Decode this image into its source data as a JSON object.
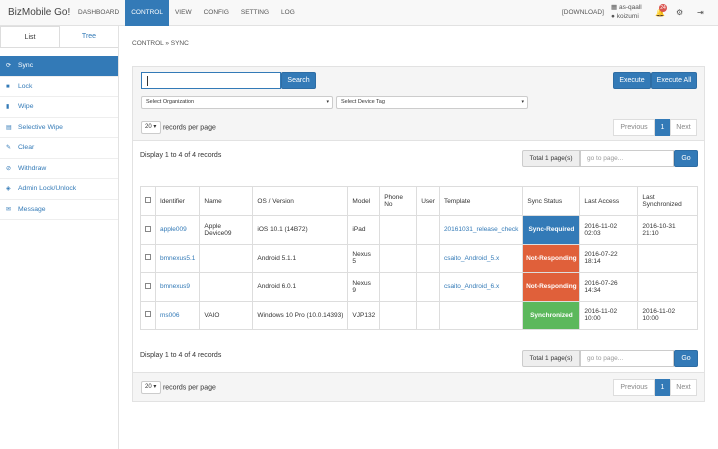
{
  "app": {
    "brand": "BizMobile Go!"
  },
  "nav": [
    "DASHBOARD",
    "CONTROL",
    "VIEW",
    "CONFIG",
    "SETTING",
    "LOG"
  ],
  "header": {
    "download": "[DOWNLOAD]",
    "user_line1": "as-qaall",
    "user_line2": "koizumi",
    "notif_count": "24"
  },
  "sidebar": {
    "tabs": [
      "List",
      "Tree"
    ],
    "items": [
      "Sync",
      "Lock",
      "Wipe",
      "Selective Wipe",
      "Clear",
      "Withdraw",
      "Admin Lock/Unlock",
      "Message"
    ]
  },
  "breadcrumb": "CONTROL » SYNC",
  "toolbar": {
    "search_label": "Search",
    "execute_label": "Execute",
    "execute_all_label": "Execute All"
  },
  "filters": {
    "org": "Select Organization",
    "tag": "Select Device Tag"
  },
  "paging": {
    "rpp_value": "20",
    "rpp_label": "records per page",
    "prev": "Previous",
    "page": "1",
    "next": "Next",
    "info": "Display 1 to 4 of 4 records",
    "total": "Total 1 page(s)",
    "goto_placeholder": "go to page...",
    "go": "Go"
  },
  "table": {
    "headers": [
      "",
      "Identifier",
      "Name",
      "OS / Version",
      "Model",
      "Phone No",
      "User",
      "Template",
      "Sync Status",
      "Last Access",
      "Last Synchronized"
    ],
    "rows": [
      {
        "id": "apple009",
        "name": "Apple Device09",
        "os": "iOS 10.1 (14B72)",
        "model": "iPad",
        "phone": "",
        "user": "",
        "template": "20161031_release_check",
        "status": "Sync-Required",
        "last_access": "2016-11-02 02:03",
        "last_sync": "2016-10-31 21:10"
      },
      {
        "id": "bmnexus5.1",
        "name": "",
        "os": "Android 5.1.1",
        "model": "Nexus 5",
        "phone": "",
        "user": "",
        "template": "csaito_Android_5.x",
        "status": "Not-Responding",
        "last_access": "2016-07-22 18:14",
        "last_sync": ""
      },
      {
        "id": "bmnexus9",
        "name": "",
        "os": "Android 6.0.1",
        "model": "Nexus 9",
        "phone": "",
        "user": "",
        "template": "csaito_Android_6.x",
        "status": "Not-Responding",
        "last_access": "2016-07-26 14:34",
        "last_sync": ""
      },
      {
        "id": "ms006",
        "name": "VAIO",
        "os": "Windows 10 Pro (10.0.14393)",
        "model": "VJP132",
        "phone": "",
        "user": "",
        "template": "",
        "status": "Synchronized",
        "last_access": "2016-11-02 10:00",
        "last_sync": "2016-11-02 10:00"
      }
    ]
  },
  "colors": {
    "primary": "#337ab7",
    "not_responding": "#e0603a",
    "synchronized": "#5cb85c"
  }
}
